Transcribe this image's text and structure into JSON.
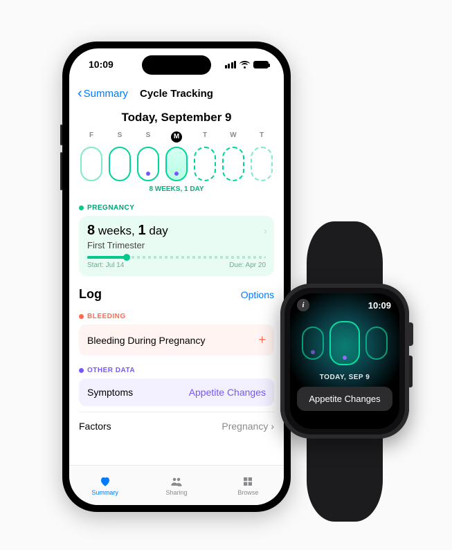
{
  "phone": {
    "status": {
      "time": "10:09"
    },
    "nav": {
      "back_label": "Summary",
      "title": "Cycle Tracking"
    },
    "today_label": "Today, September 9",
    "weekdays": [
      "F",
      "S",
      "S",
      "M",
      "T",
      "W",
      "T"
    ],
    "today_index": 3,
    "duration_caption": "8 WEEKS, 1 DAY",
    "pregnancy": {
      "section_label": "PREGNANCY",
      "weeks_num": "8",
      "weeks_word": "weeks,",
      "days_num": "1",
      "days_word": "day",
      "trimester": "First Trimester",
      "start_label": "Start: Jul 14",
      "due_label": "Due: Apr 20"
    },
    "log": {
      "heading": "Log",
      "options": "Options",
      "bleeding_label": "BLEEDING",
      "bleeding_row": "Bleeding During Pregnancy",
      "other_label": "OTHER DATA",
      "symptoms_label": "Symptoms",
      "symptoms_value": "Appetite Changes",
      "factors_label": "Factors",
      "factors_value": "Pregnancy"
    },
    "tabs": {
      "summary": "Summary",
      "sharing": "Sharing",
      "browse": "Browse"
    }
  },
  "watch": {
    "time": "10:09",
    "date": "TODAY, SEP 9",
    "chip": "Appetite Changes"
  }
}
